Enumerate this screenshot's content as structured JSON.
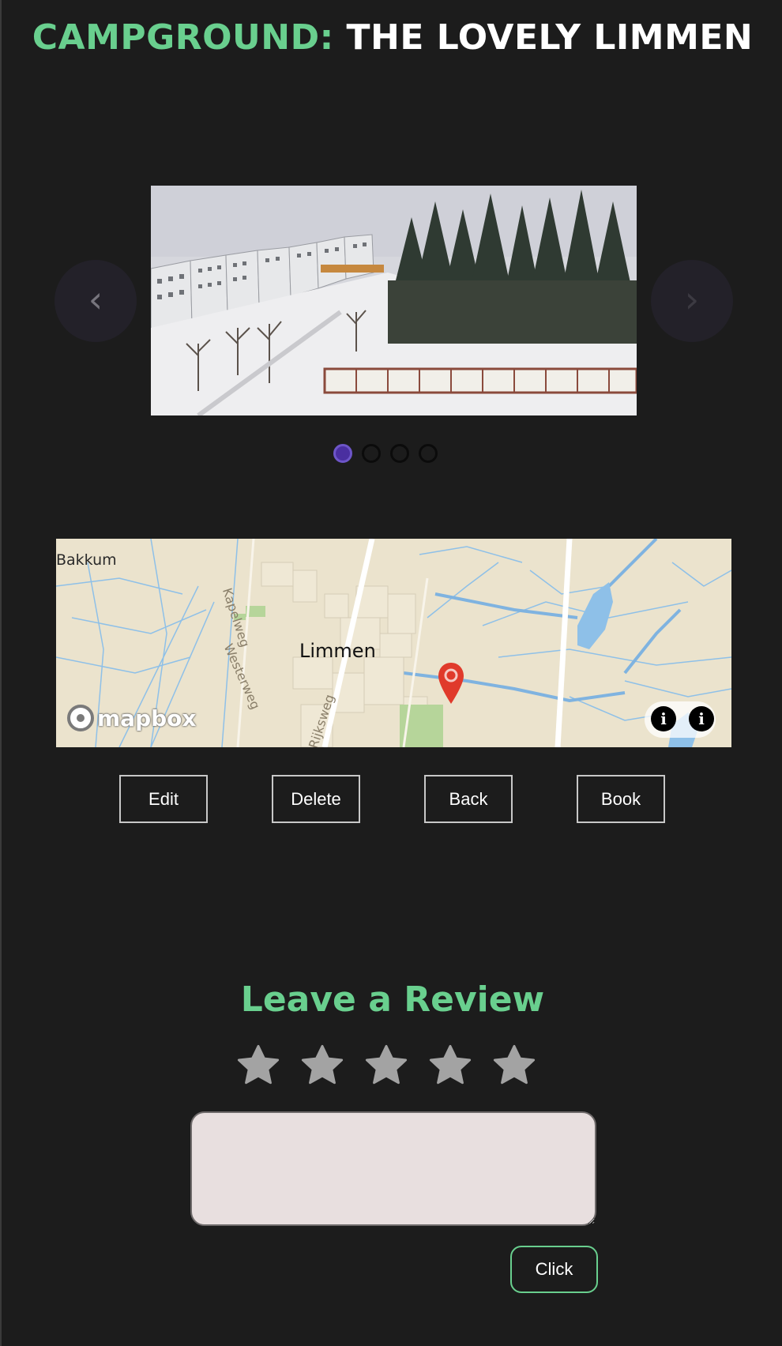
{
  "header": {
    "label": "CAMPGROUND:",
    "name": "THE LOVELY LIMMEN"
  },
  "carousel": {
    "prev_label": "‹",
    "next_label": "›",
    "slide_count": 4,
    "active_index": 0,
    "image_description_icon": "snowy-apartments-photo"
  },
  "map": {
    "provider": "mapbox",
    "places": {
      "bakkum": "Bakkum",
      "limmen": "Limmen"
    },
    "streets": {
      "kapelweg": "Kapelweg",
      "westerweg": "Westerweg",
      "rijksweg": "Rijksweg"
    },
    "info_glyph": "i",
    "colors": {
      "land": "#ebe3cd",
      "water": "#8ec0e8",
      "pin": "#e03a2b"
    }
  },
  "actions": {
    "edit": "Edit",
    "delete": "Delete",
    "back": "Back",
    "book": "Book"
  },
  "review": {
    "heading": "Leave a Review",
    "rating_max": 5,
    "rating_value": 0,
    "text_value": "",
    "submit": "Click"
  },
  "colors": {
    "background": "#1c1c1c",
    "accent": "#69cf8e",
    "dot_active": "#4a2fa0",
    "star": "#a3a3a3"
  }
}
